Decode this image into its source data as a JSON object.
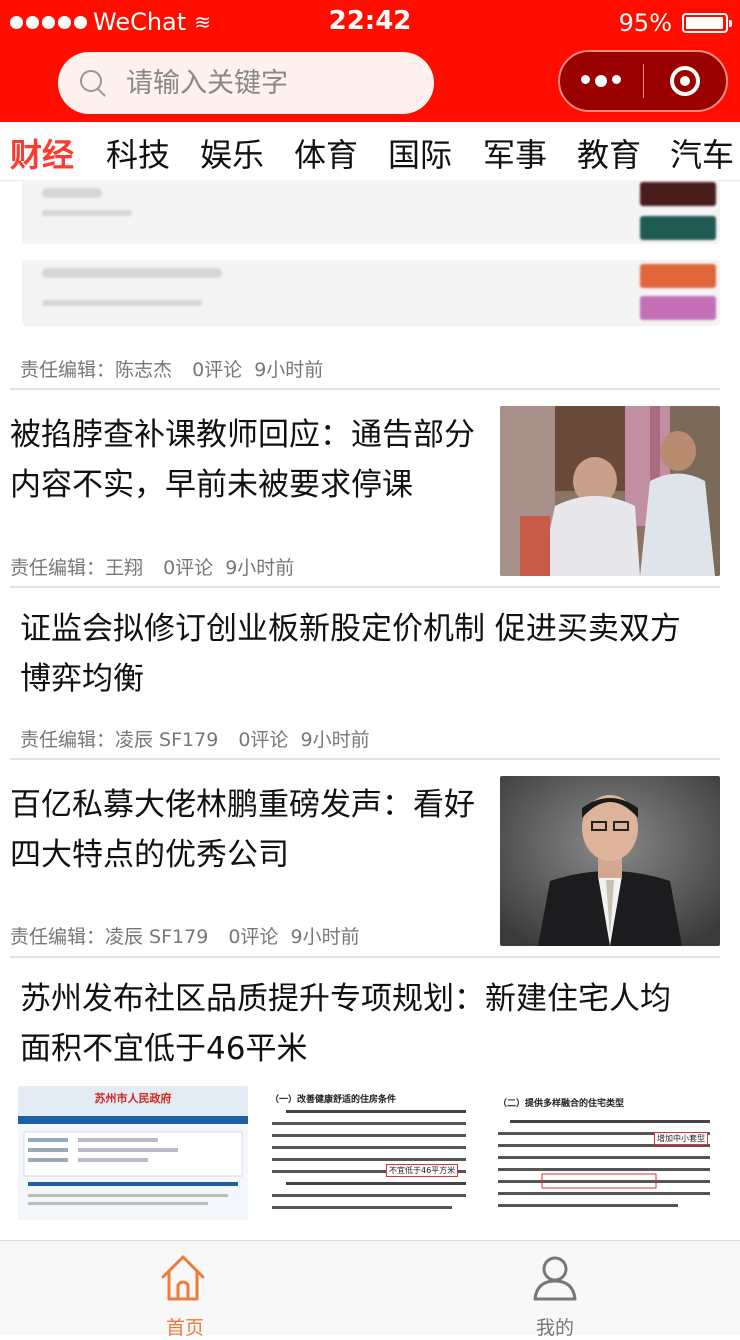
{
  "status_bar": {
    "carrier": "WeChat",
    "time": "22:42",
    "battery": "95%"
  },
  "search": {
    "placeholder": "请输入关键字"
  },
  "tabs": [
    {
      "label": "财经",
      "active": true
    },
    {
      "label": "科技",
      "active": false
    },
    {
      "label": "娱乐",
      "active": false
    },
    {
      "label": "体育",
      "active": false
    },
    {
      "label": "国际",
      "active": false
    },
    {
      "label": "军事",
      "active": false
    },
    {
      "label": "教育",
      "active": false
    },
    {
      "label": "汽车",
      "active": false
    }
  ],
  "articles": [
    {
      "title": "",
      "editor": "责任编辑：陈志杰",
      "comments": "0评论",
      "time": "9小时前"
    },
    {
      "title_line1": "被掐脖查补课教师回应：通告部分",
      "title_line2": "内容不实，早前未被要求停课",
      "editor": "责任编辑：王翔",
      "comments": "0评论",
      "time": "9小时前"
    },
    {
      "title_line1": "证监会拟修订创业板新股定价机制 促进买卖双方",
      "title_line2": "博弈均衡",
      "editor": "责任编辑：凌辰 SF179",
      "comments": "0评论",
      "time": "9小时前"
    },
    {
      "title_line1": "百亿私募大佬林鹏重磅发声：看好",
      "title_line2": "四大特点的优秀公司",
      "editor": "责任编辑：凌辰 SF179",
      "comments": "0评论",
      "time": "9小时前"
    },
    {
      "title_line1": "苏州发布社区品质提升专项规划：新建住宅人均",
      "title_line2": "面积不宜低于46平米"
    }
  ],
  "doc_images": {
    "gov_title": "苏州市人民政府",
    "section_one": "（一）改善健康舒适的住房条件",
    "section_two": "（二）提供多样融合的住宅类型",
    "highlight_1": "不宜低于46平方米",
    "highlight_2": "增加中小套型"
  },
  "bottom_nav": [
    {
      "label": "首页",
      "icon": "home-icon",
      "active": true
    },
    {
      "label": "我的",
      "icon": "user-icon",
      "active": false
    }
  ],
  "colors": {
    "brand_red": "#ff0e00",
    "active_tab": "#ff3a2e",
    "nav_active": "#f07a3a",
    "meta_gray": "#777777"
  }
}
